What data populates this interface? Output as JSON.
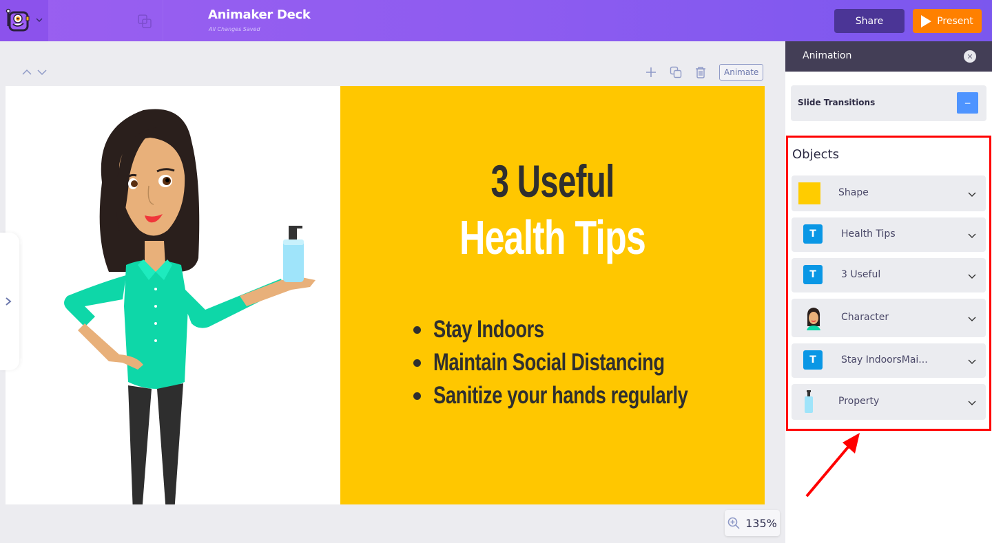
{
  "topbar": {
    "app_title": "Animaker Deck",
    "save_status": "All Changes Saved",
    "share_label": "Share",
    "present_label": "Present",
    "colors": {
      "share": "#4B3596",
      "present": "#FF8000",
      "bar": "#9A5FF0"
    }
  },
  "canvas": {
    "animate_label": "Animate",
    "zoom_level": "135%"
  },
  "slide": {
    "title_line1": "3 Useful",
    "title_line2": "Health Tips",
    "bullets": [
      "Stay Indoors",
      "Maintain Social Distancing",
      "Sanitize your hands regularly"
    ],
    "colors": {
      "panel": "#FFC700",
      "title_dark": "#2F2F2F",
      "title_light": "#FFFFFF"
    }
  },
  "panel": {
    "title": "Animation",
    "slide_transitions_label": "Slide Transitions",
    "slide_transitions_toggle": "−",
    "objects_title": "Objects",
    "objects": [
      {
        "label": "Shape",
        "icon": "yellow-shape"
      },
      {
        "label": "Health Tips",
        "icon": "text-T"
      },
      {
        "label": "3 Useful",
        "icon": "text-T"
      },
      {
        "label": "Character",
        "icon": "character-avatar"
      },
      {
        "label": "Stay IndoorsMai...",
        "icon": "text-T"
      },
      {
        "label": "Property",
        "icon": "sanitizer-bottle"
      }
    ],
    "text_badge": "T"
  },
  "annotation": {
    "highlight_color": "#FF0000"
  }
}
